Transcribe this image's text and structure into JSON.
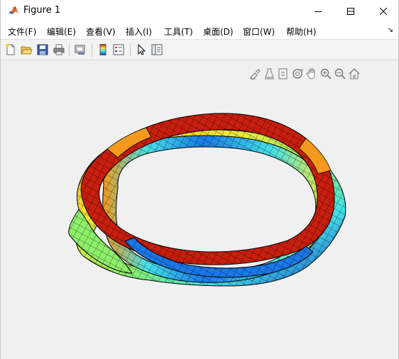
{
  "window": {
    "title": "Figure 1",
    "icon": "matlab-logo-icon",
    "controls": [
      "minimize-icon",
      "maximize-icon",
      "close-icon"
    ]
  },
  "menu": {
    "items": [
      {
        "label": "文件(F)"
      },
      {
        "label": "编辑(E)"
      },
      {
        "label": "查看(V)"
      },
      {
        "label": "插入(I)"
      },
      {
        "label": "工具(T)"
      },
      {
        "label": "桌面(D)"
      },
      {
        "label": "窗口(W)"
      },
      {
        "label": "帮助(H)"
      }
    ],
    "collapse_glyph": "↘"
  },
  "toolbar": {
    "buttons": [
      "new-figure-icon",
      "open-file-icon",
      "save-icon",
      "print-icon",
      "link-plot-icon",
      "insert-colorbar-icon",
      "insert-legend-icon",
      "edit-plot-icon",
      "property-inspector-icon"
    ]
  },
  "axes_toolbar": {
    "buttons": [
      "brush-icon",
      "data-tips-icon",
      "restore-view-icon",
      "rotate-3d-icon",
      "pan-icon",
      "zoom-in-icon",
      "zoom-out-icon",
      "home-icon"
    ]
  },
  "plot": {
    "type": "3d-surface",
    "description_colormap": "jet",
    "colors": {
      "red": "#c81e0e",
      "orange": "#f39a1e",
      "yellow": "#f4e83a",
      "green": "#8ef06a",
      "cyan": "#44e0e8",
      "blue": "#1a78e8",
      "navy": "#1438c8",
      "edge": "#000000"
    }
  }
}
